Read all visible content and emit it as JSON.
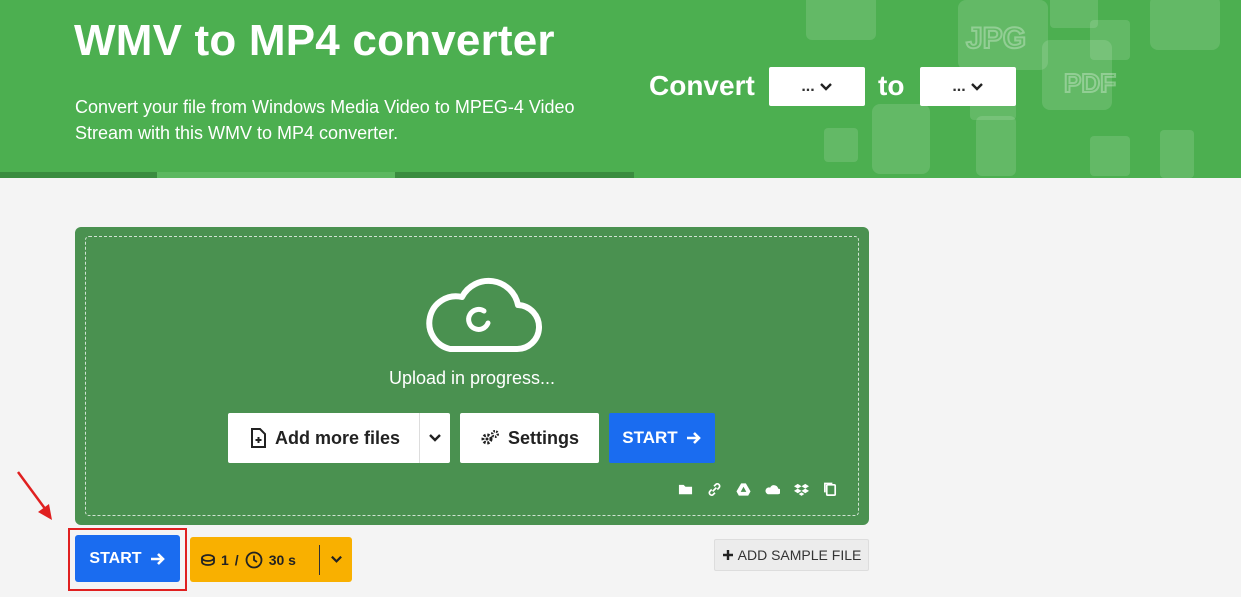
{
  "header": {
    "title": "WMV to MP4 converter",
    "subtitle": "Convert your file from Windows Media Video to MPEG-4 Video Stream with this WMV to MP4 converter.",
    "convert_label": "Convert",
    "to_label": "to",
    "from_select_value": "...",
    "to_select_value": "..."
  },
  "upload": {
    "status_text": "Upload in progress...",
    "add_files_label": "Add more files",
    "settings_label": "Settings",
    "start_label": "START",
    "source_icons": [
      "folder-icon",
      "link-icon",
      "google-drive-icon",
      "onedrive-icon",
      "dropbox-icon",
      "clipboard-icon"
    ]
  },
  "footer_controls": {
    "start_label": "START",
    "credits": "1",
    "separator": "/",
    "time": "30 s",
    "add_sample_label": "ADD SAMPLE FILE"
  },
  "colors": {
    "header_green": "#4caf50",
    "upload_green": "#4a9150",
    "start_blue": "#1a6cf0",
    "credit_yellow": "#f9b000",
    "highlight_red": "#e02020"
  }
}
